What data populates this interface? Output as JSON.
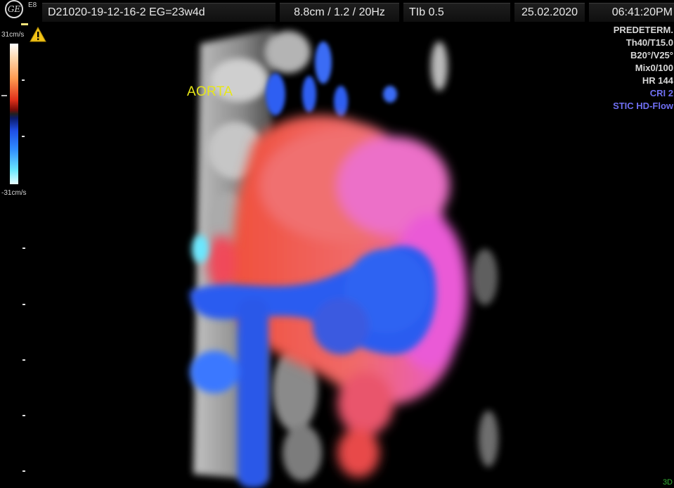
{
  "header": {
    "logo_text": "GE",
    "probe": "E8",
    "patient_id": "D21020-19-12-16-2  EG=23w4d",
    "depth_freq": "8.8cm / 1.2 / 20Hz",
    "tib": "TIb  0.5",
    "date": "25.02.2020",
    "time": "06:41:20PM"
  },
  "colorbar": {
    "top_label": "31cm/s",
    "bottom_label": "-31cm/s",
    "icon": "warning-icon"
  },
  "annotation": {
    "label": "AORTA",
    "color": "#e6e619"
  },
  "parameters": [
    {
      "text": "PREDETERM.",
      "color": "#d8d8d8"
    },
    {
      "text": "Th40/T15.0",
      "color": "#d8d8d8"
    },
    {
      "text": "B20°/V25°",
      "color": "#d8d8d8"
    },
    {
      "text": "Mix0/100",
      "color": "#d8d8d8"
    },
    {
      "text": "HR 144",
      "color": "#d8d8d8"
    },
    {
      "text": "CRI 2",
      "color": "#6f6ff2"
    },
    {
      "text": "STIC HD-Flow",
      "color": "#6f6ff2"
    }
  ],
  "mode": "3D",
  "colors": {
    "flow_red": "#f0503c",
    "flow_pink": "#f06ad2",
    "flow_blue": "#2a5cf0",
    "tissue": "#bdbdbd"
  }
}
